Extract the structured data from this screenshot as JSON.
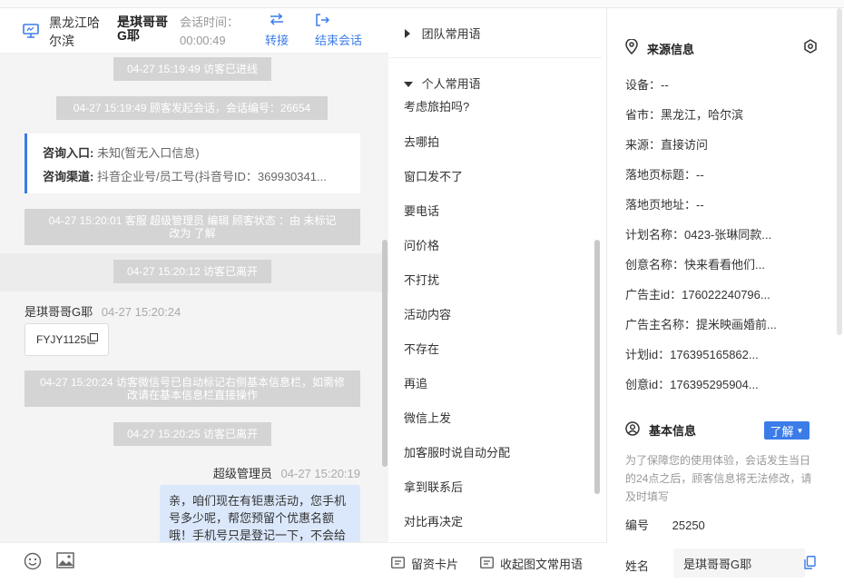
{
  "header": {
    "location": [
      "黑龙江哈",
      "尔滨"
    ],
    "visitor_name": [
      "是琪哥哥",
      "G耶"
    ],
    "session_time_label": "会话时间：",
    "session_time_value": "00:00:49",
    "transfer_label": "转接",
    "end_session_label": "结束会话"
  },
  "messages": {
    "sys1": "04-27 15:19:49 访客已进线",
    "sys2": "04-27 15:19:49 顾客发起会话，会话编号：26654",
    "entry_label": "咨询入口:",
    "entry_value": "未知(暂无入口信息)",
    "channel_label": "咨询渠道:",
    "channel_value": "抖音企业号/员工号(抖音号ID：369930341...",
    "sys3": "04-27 15:20:01 客服 超级管理员 编辑 顾客状态 ：由 未标记 改为 了解",
    "sys4": "04-27 15:20:12 访客已离开",
    "visitor_sender": "是琪哥哥G耶",
    "visitor_time": "04-27 15:20:24",
    "wechat_id": "FYJY1125",
    "sys5": "04-27 15:20:24 访客微信号已自动标记右侧基本信息栏，如需修改请在基本信息栏直接操作",
    "sys6": "04-27 15:20:25 访客已离开",
    "agent_sender": "超级管理员",
    "agent_time": "04-27 15:20:19",
    "agent_msg": "亲，咱们现在有钜惠活动，您手机号多少呢，帮您预留个优惠名额哦！手机号只是登记一下，不会给"
  },
  "footer": {
    "leave_card": "留资卡片",
    "collapse_phrases": "收起图文常用语"
  },
  "phrases": {
    "team_title": "团队常用语",
    "personal_title": "个人常用语",
    "items": [
      "考虑旅拍吗?",
      "去哪拍",
      "窗口发不了",
      "要电话",
      "问价格",
      "不打扰",
      "活动内容",
      "不存在",
      "再追",
      "微信上发",
      "加客服时说自动分配",
      "拿到联系后",
      "对比再决定"
    ]
  },
  "info": {
    "source_title": "来源信息",
    "source_rows": [
      "设备：--",
      "省市：黑龙江，哈尔滨",
      "来源：直接访问",
      "落地页标题：--",
      "落地页地址：--",
      "计划名称：0423-张琳同款...",
      "创意名称：快来看看他们...",
      "广告主id：176022240796...",
      "广告主名称：提米映画婚前...",
      "计划id：176395165862...",
      "创意id：176395295904..."
    ],
    "basic_title": "基本信息",
    "status_badge": "了解",
    "notice": [
      "为了保障您的使用体验，会话发生当日",
      "的24点之后，顾客信息将无法修改，请",
      "及时填写"
    ],
    "number_label": "编号",
    "number_value": "25250",
    "name_label": "姓名",
    "name_value": "是琪哥哥G耶"
  },
  "colors": {
    "accent": "#3b7ce9",
    "system_bubble": "#d4d4d4",
    "chat_bg": "#f4f4f5",
    "agent_bubble": "#dbe8fb"
  }
}
